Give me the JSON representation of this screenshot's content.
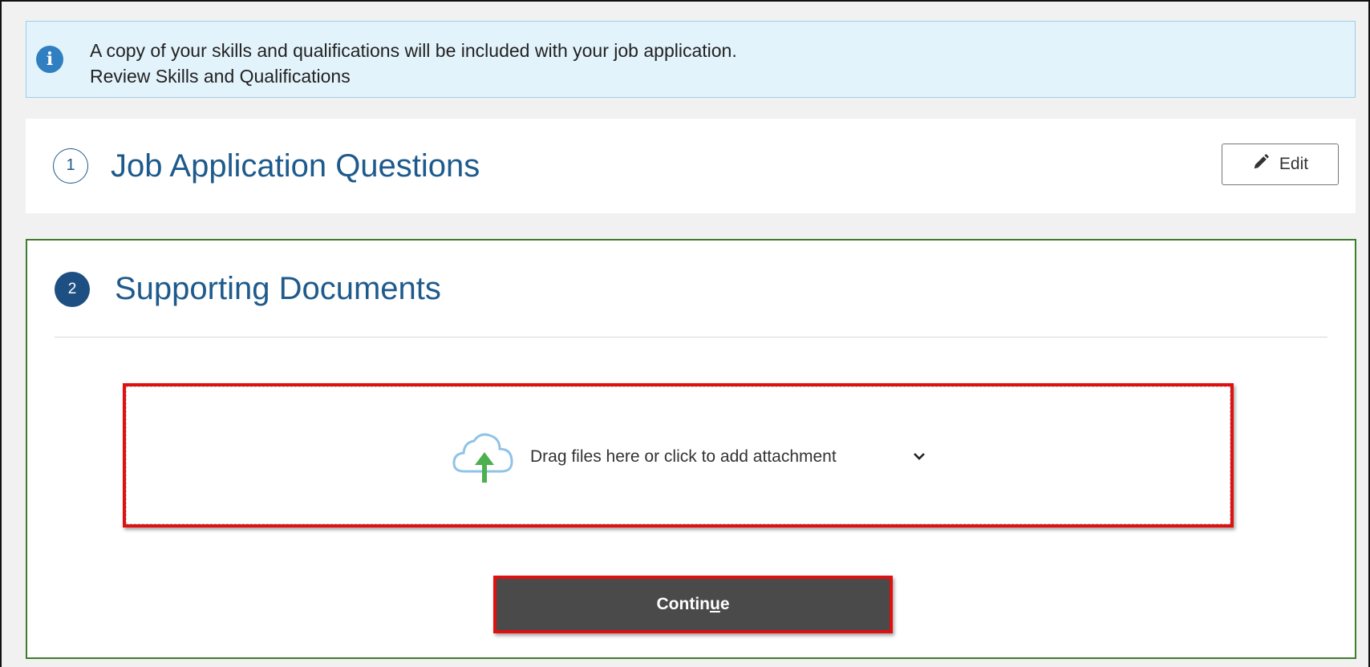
{
  "banner": {
    "icon": "info-icon",
    "message": "A copy of your skills and qualifications will be included with your job application.",
    "link_text": "Review Skills and Qualifications",
    "colors": {
      "background": "#e3f3fb",
      "border": "#9ccfe8",
      "icon": "#2f7fc1"
    }
  },
  "step1": {
    "number": "1",
    "title": "Job Application Questions",
    "edit_label": "Edit",
    "edit_icon": "pencil-icon"
  },
  "step2": {
    "number": "2",
    "title": "Supporting Documents",
    "active_border_color": "#3e7d2b",
    "dropzone": {
      "icon": "cloud-upload-icon",
      "label": "Drag files here or click to add attachment",
      "chevron_icon": "chevron-down-icon"
    },
    "continue_prefix": "Contin",
    "continue_mnemonic": "u",
    "continue_suffix": "e"
  },
  "colors": {
    "heading": "#1e5a8c",
    "step_filled": "#1e4f82",
    "highlight": "#e01010",
    "continue_bg": "#4a4a4a"
  }
}
